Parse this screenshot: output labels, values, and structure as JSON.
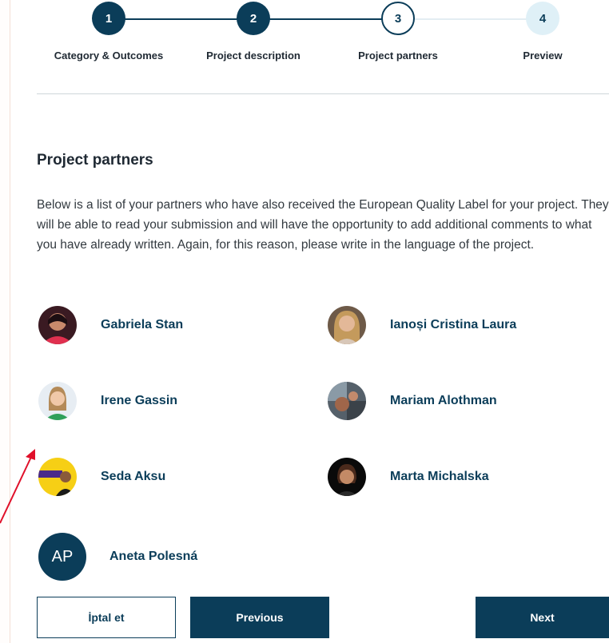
{
  "stepper": {
    "steps": [
      {
        "number": "1",
        "label": "Category & Outcomes",
        "state": "done"
      },
      {
        "number": "2",
        "label": "Project description",
        "state": "done"
      },
      {
        "number": "3",
        "label": "Project partners",
        "state": "current"
      },
      {
        "number": "4",
        "label": "Preview",
        "state": "todo"
      }
    ]
  },
  "section": {
    "title": "Project partners",
    "description": "Below is a list of your partners who have also received the European Quality Label for your project. They will be able to read your submission and will have the opportunity to add additional comments to what you have already written. Again, for this reason, please write in the language of the project."
  },
  "partners": [
    {
      "name": "Gabriela Stan"
    },
    {
      "name": "Ianoși Cristina Laura"
    },
    {
      "name": "Irene Gassin"
    },
    {
      "name": "Mariam Alothman"
    },
    {
      "name": "Seda Aksu"
    },
    {
      "name": "Marta Michalska"
    },
    {
      "name": "Aneta Polesná",
      "initials": "AP"
    }
  ],
  "buttons": {
    "cancel": "İptal et",
    "previous": "Previous",
    "next": "Next"
  },
  "colors": {
    "primary": "#0b3d59",
    "upcoming_step": "#dff0f7",
    "annotation_arrow": "#e0102a"
  }
}
